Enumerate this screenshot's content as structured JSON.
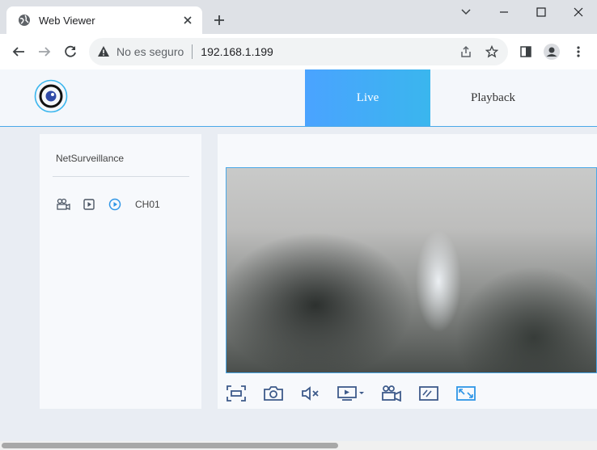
{
  "browser": {
    "tab_title": "Web Viewer",
    "new_tab_label": "+",
    "security_label": "No es seguro",
    "url": "192.168.1.199"
  },
  "app": {
    "nav": {
      "live": "Live",
      "playback": "Playback"
    },
    "sidebar": {
      "title": "NetSurveillance",
      "channel": "CH01"
    }
  },
  "colors": {
    "accent": "#3ab6ee",
    "active_tab_gradient_start": "#4aa3ff",
    "border": "#4aa8e8"
  },
  "icons": {
    "browser": [
      "globe-icon",
      "close-icon",
      "plus-icon",
      "minimize-icon",
      "maximize-icon",
      "window-close-icon",
      "back-icon",
      "forward-icon",
      "reload-icon",
      "warning-icon",
      "share-icon",
      "star-icon",
      "sidebar-icon",
      "profile-icon",
      "menu-icon"
    ],
    "sidebar": [
      "camera-group-icon",
      "playback-icon",
      "play-circle-icon"
    ],
    "video_toolbar": [
      "fullscreen-icon",
      "snapshot-icon",
      "mute-icon",
      "stream-select-icon",
      "record-icon",
      "stretch-icon",
      "aspect-fit-icon"
    ]
  }
}
